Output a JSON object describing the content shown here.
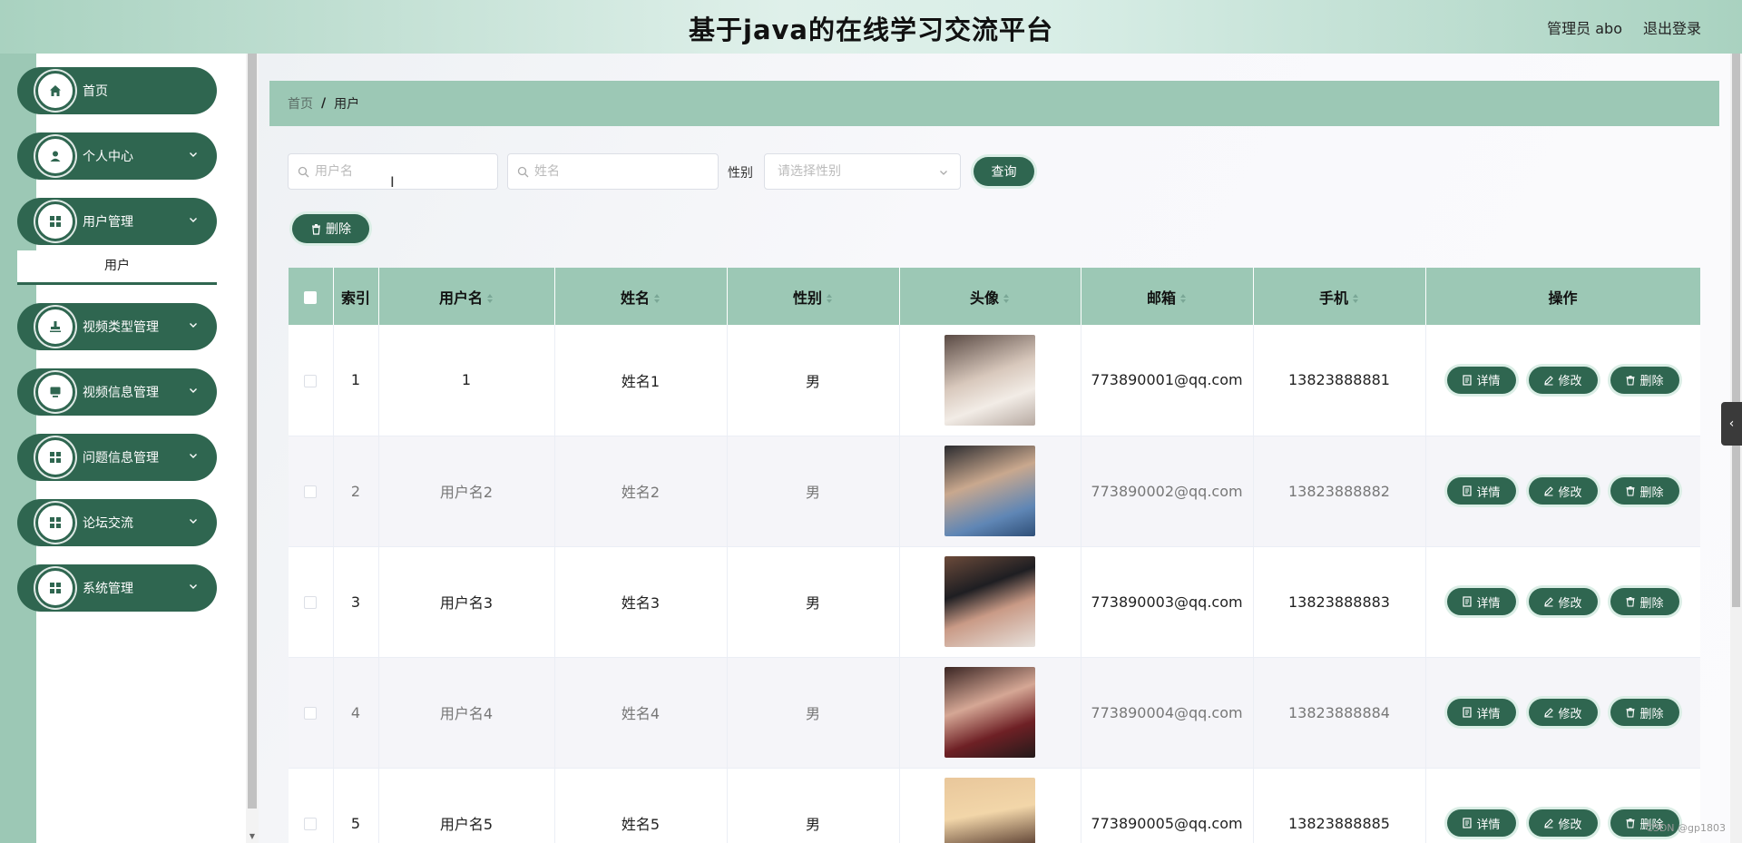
{
  "header": {
    "title": "基于java的在线学习交流平台",
    "user": "管理员 abo",
    "logout": "退出登录"
  },
  "sidebar": {
    "items": [
      {
        "label": "首页",
        "icon": "home-icon"
      },
      {
        "label": "个人中心",
        "icon": "user-icon"
      },
      {
        "label": "用户管理",
        "icon": "grid-icon"
      },
      {
        "label": "视频类型管理",
        "icon": "stamp-icon"
      },
      {
        "label": "视频信息管理",
        "icon": "monitor-icon"
      },
      {
        "label": "问题信息管理",
        "icon": "grid-icon"
      },
      {
        "label": "论坛交流",
        "icon": "grid-icon"
      },
      {
        "label": "系统管理",
        "icon": "grid-icon"
      }
    ],
    "submenu": {
      "label": "用户"
    }
  },
  "breadcrumb": {
    "home": "首页",
    "sep": "/",
    "current": "用户"
  },
  "search": {
    "username_placeholder": "用户名",
    "name_placeholder": "姓名",
    "gender_label": "性别",
    "gender_placeholder": "请选择性别",
    "query_label": "查询",
    "delete_label": "删除"
  },
  "table": {
    "headers": {
      "index": "索引",
      "username": "用户名",
      "name": "姓名",
      "gender": "性别",
      "avatar": "头像",
      "email": "邮箱",
      "phone": "手机",
      "actions": "操作"
    },
    "actions": {
      "detail": "详情",
      "edit": "修改",
      "delete": "删除"
    },
    "rows": [
      {
        "index": "1",
        "username": "1",
        "name": "姓名1",
        "gender": "男",
        "email": "773890001@qq.com",
        "phone": "13823888881"
      },
      {
        "index": "2",
        "username": "用户名2",
        "name": "姓名2",
        "gender": "男",
        "email": "773890002@qq.com",
        "phone": "13823888882"
      },
      {
        "index": "3",
        "username": "用户名3",
        "name": "姓名3",
        "gender": "男",
        "email": "773890003@qq.com",
        "phone": "13823888883"
      },
      {
        "index": "4",
        "username": "用户名4",
        "name": "姓名4",
        "gender": "男",
        "email": "773890004@qq.com",
        "phone": "13823888884"
      },
      {
        "index": "5",
        "username": "用户名5",
        "name": "姓名5",
        "gender": "男",
        "email": "773890005@qq.com",
        "phone": "13823888885"
      }
    ]
  },
  "watermark": "CSDN @gp1803",
  "colors": {
    "primary": "#2f6650",
    "header_bg": "#9cc8b5"
  }
}
